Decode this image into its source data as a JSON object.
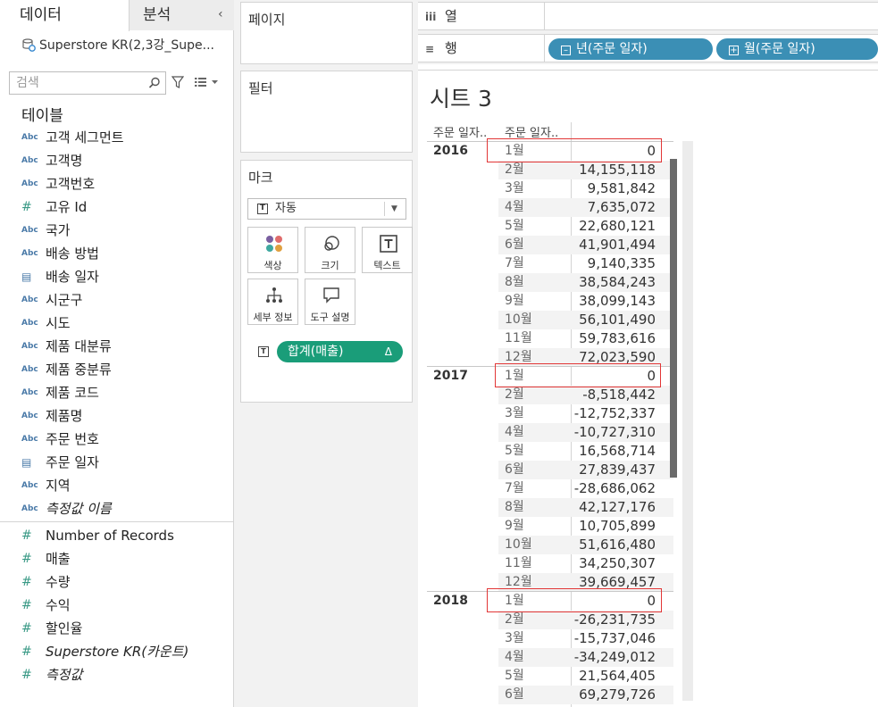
{
  "tabs": {
    "data": "데이터",
    "analysis": "분석"
  },
  "datasource": {
    "name": "Superstore KR(2,3강_Supe..."
  },
  "search": {
    "placeholder": "검색"
  },
  "tables_header": "테이블",
  "dimensions": [
    {
      "type": "Abc",
      "name": "고객 세그먼트"
    },
    {
      "type": "Abc",
      "name": "고객명"
    },
    {
      "type": "Abc",
      "name": "고객번호"
    },
    {
      "type": "#",
      "name": "고유 Id"
    },
    {
      "type": "Abc",
      "name": "국가"
    },
    {
      "type": "Abc",
      "name": "배송 방법"
    },
    {
      "type": "calendar",
      "name": "배송 일자"
    },
    {
      "type": "Abc",
      "name": "시군구"
    },
    {
      "type": "Abc",
      "name": "시도"
    },
    {
      "type": "Abc",
      "name": "제품 대분류"
    },
    {
      "type": "Abc",
      "name": "제품 중분류"
    },
    {
      "type": "Abc",
      "name": "제품 코드"
    },
    {
      "type": "Abc",
      "name": "제품명"
    },
    {
      "type": "Abc",
      "name": "주문 번호"
    },
    {
      "type": "calendar",
      "name": "주문 일자"
    },
    {
      "type": "Abc",
      "name": "지역"
    },
    {
      "type": "Abc",
      "name": "측정값 이름",
      "italic": true
    }
  ],
  "measures": [
    {
      "type": "#",
      "name": "Number of Records"
    },
    {
      "type": "#",
      "name": "매출"
    },
    {
      "type": "#",
      "name": "수량"
    },
    {
      "type": "#",
      "name": "수익"
    },
    {
      "type": "#",
      "name": "할인율"
    },
    {
      "type": "#",
      "name": "Superstore KR(카운트)",
      "italic": true
    },
    {
      "type": "#",
      "name": "측정값",
      "italic": true
    }
  ],
  "cards": {
    "pages": "페이지",
    "filters": "필터",
    "marks": "마크",
    "marks_type": "자동",
    "mark_buttons": {
      "color": "색상",
      "size": "크기",
      "text": "텍스트",
      "detail": "세부 정보",
      "tooltip": "도구 설명"
    },
    "measure_pill": "합계(매출)",
    "measure_pill_delta": "Δ"
  },
  "shelves": {
    "columns_label": "열",
    "rows_label": "행",
    "row_pills": [
      "년(주문 일자)",
      "월(주문 일자)"
    ]
  },
  "sheet": {
    "title": "시트 3",
    "col_headers": [
      "주문 일자..",
      "주문 일자.."
    ]
  },
  "table": {
    "years": [
      {
        "year": "2016",
        "rows": [
          {
            "month": "1월",
            "value": "0"
          },
          {
            "month": "2월",
            "value": "14,155,118"
          },
          {
            "month": "3월",
            "value": "9,581,842"
          },
          {
            "month": "4월",
            "value": "7,635,072"
          },
          {
            "month": "5월",
            "value": "22,680,121"
          },
          {
            "month": "6월",
            "value": "41,901,494"
          },
          {
            "month": "7월",
            "value": "9,140,335"
          },
          {
            "month": "8월",
            "value": "38,584,243"
          },
          {
            "month": "9월",
            "value": "38,099,143"
          },
          {
            "month": "10월",
            "value": "56,101,490"
          },
          {
            "month": "11월",
            "value": "59,783,616"
          },
          {
            "month": "12월",
            "value": "72,023,590"
          }
        ]
      },
      {
        "year": "2017",
        "rows": [
          {
            "month": "1월",
            "value": "0"
          },
          {
            "month": "2월",
            "value": "-8,518,442"
          },
          {
            "month": "3월",
            "value": "-12,752,337"
          },
          {
            "month": "4월",
            "value": "-10,727,310"
          },
          {
            "month": "5월",
            "value": "16,568,714"
          },
          {
            "month": "6월",
            "value": "27,839,437"
          },
          {
            "month": "7월",
            "value": "-28,686,062"
          },
          {
            "month": "8월",
            "value": "42,127,176"
          },
          {
            "month": "9월",
            "value": "10,705,899"
          },
          {
            "month": "10월",
            "value": "51,616,480"
          },
          {
            "month": "11월",
            "value": "34,250,307"
          },
          {
            "month": "12월",
            "value": "39,669,457"
          }
        ]
      },
      {
        "year": "2018",
        "rows": [
          {
            "month": "1월",
            "value": "0"
          },
          {
            "month": "2월",
            "value": "-26,231,735"
          },
          {
            "month": "3월",
            "value": "-15,737,046"
          },
          {
            "month": "4월",
            "value": "-34,249,012"
          },
          {
            "month": "5월",
            "value": "21,564,405"
          },
          {
            "month": "6월",
            "value": "69,279,726"
          }
        ]
      }
    ]
  },
  "colors": {
    "measure_pill": "#1a9d79",
    "dimension_pill": "#3b8fb5",
    "highlight": "#e23636"
  }
}
